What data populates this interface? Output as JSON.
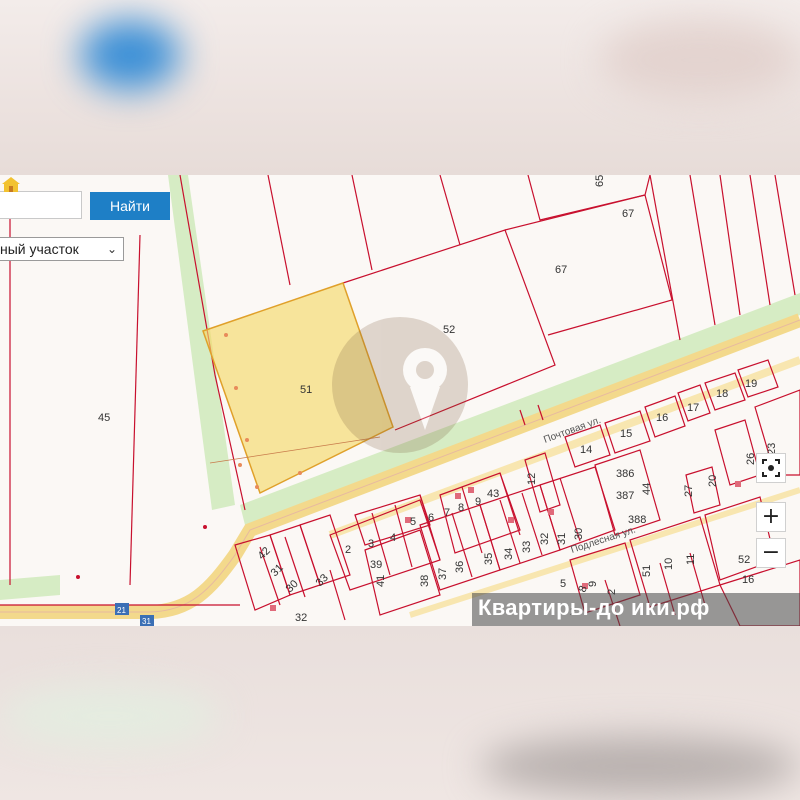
{
  "search": {
    "button_label": "Найти",
    "placeholder": ""
  },
  "filter": {
    "selected": "ный участок",
    "chevron_icon": "chevron-down-icon"
  },
  "controls": {
    "locate_icon": "target-icon",
    "zoom_in": "+",
    "zoom_out": "−"
  },
  "map": {
    "highlight_color": "#f5d86a",
    "boundary_color": "#c8102e",
    "road_color": "#f6dc8a",
    "green_color": "#cfe8b9",
    "streets": [
      "Почтовая ул.",
      "Подлесная ул."
    ],
    "route_shields": [
      "21",
      "31"
    ],
    "parcel_labels": [
      "45",
      "51",
      "52",
      "65",
      "67",
      "67",
      "2",
      "3",
      "4",
      "5",
      "6",
      "7",
      "8",
      "9",
      "43",
      "12",
      "14",
      "15",
      "16",
      "17",
      "18",
      "19",
      "23",
      "26",
      "27",
      "20",
      "44",
      "386",
      "387",
      "388",
      "30",
      "31",
      "32",
      "33",
      "34",
      "35",
      "36",
      "37",
      "38",
      "39",
      "41",
      "42",
      "31",
      "30",
      "32",
      "33",
      "51",
      "10",
      "11",
      "52",
      "2",
      "9",
      "8",
      "5",
      "16",
      "2",
      "32"
    ]
  },
  "watermark": {
    "text": "Квартиры-до ики.рф"
  }
}
